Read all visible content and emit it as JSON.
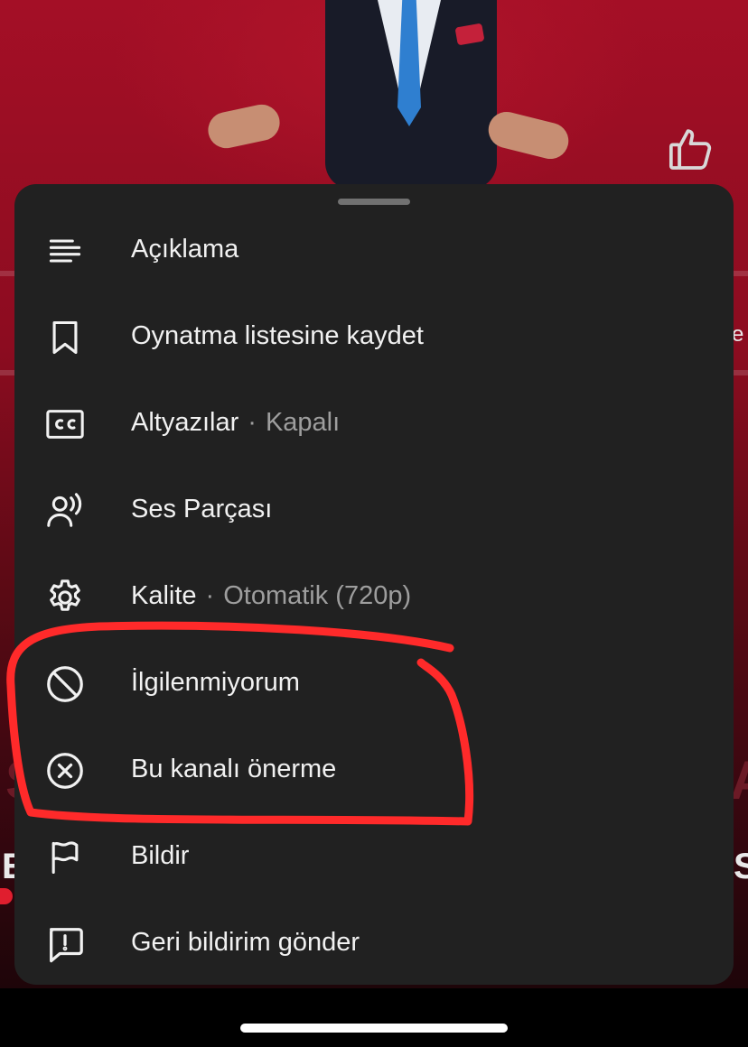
{
  "menu": {
    "items": [
      {
        "icon": "description-icon",
        "label": "Açıklama",
        "sub": ""
      },
      {
        "icon": "bookmark-icon",
        "label": "Oynatma listesine kaydet",
        "sub": ""
      },
      {
        "icon": "cc-icon",
        "label": "Altyazılar",
        "sub": "Kapalı"
      },
      {
        "icon": "audio-track-icon",
        "label": "Ses Parçası",
        "sub": ""
      },
      {
        "icon": "gear-icon",
        "label": "Kalite",
        "sub": "Otomatik (720p)"
      },
      {
        "icon": "not-interested-icon",
        "label": "İlgilenmiyorum",
        "sub": ""
      },
      {
        "icon": "close-circle-icon",
        "label": "Bu kanalı önerme",
        "sub": ""
      },
      {
        "icon": "flag-icon",
        "label": "Bildir",
        "sub": ""
      },
      {
        "icon": "feedback-icon",
        "label": "Geri bildirim gönder",
        "sub": ""
      }
    ],
    "separator": "·"
  },
  "video": {
    "edge_letters": [
      "e",
      "S",
      "A",
      "E",
      "S"
    ]
  },
  "colors": {
    "sheet_bg": "#212121",
    "text": "#f1f1f1",
    "secondary_text": "#9e9e9e",
    "annotation": "#ff2a2a"
  }
}
